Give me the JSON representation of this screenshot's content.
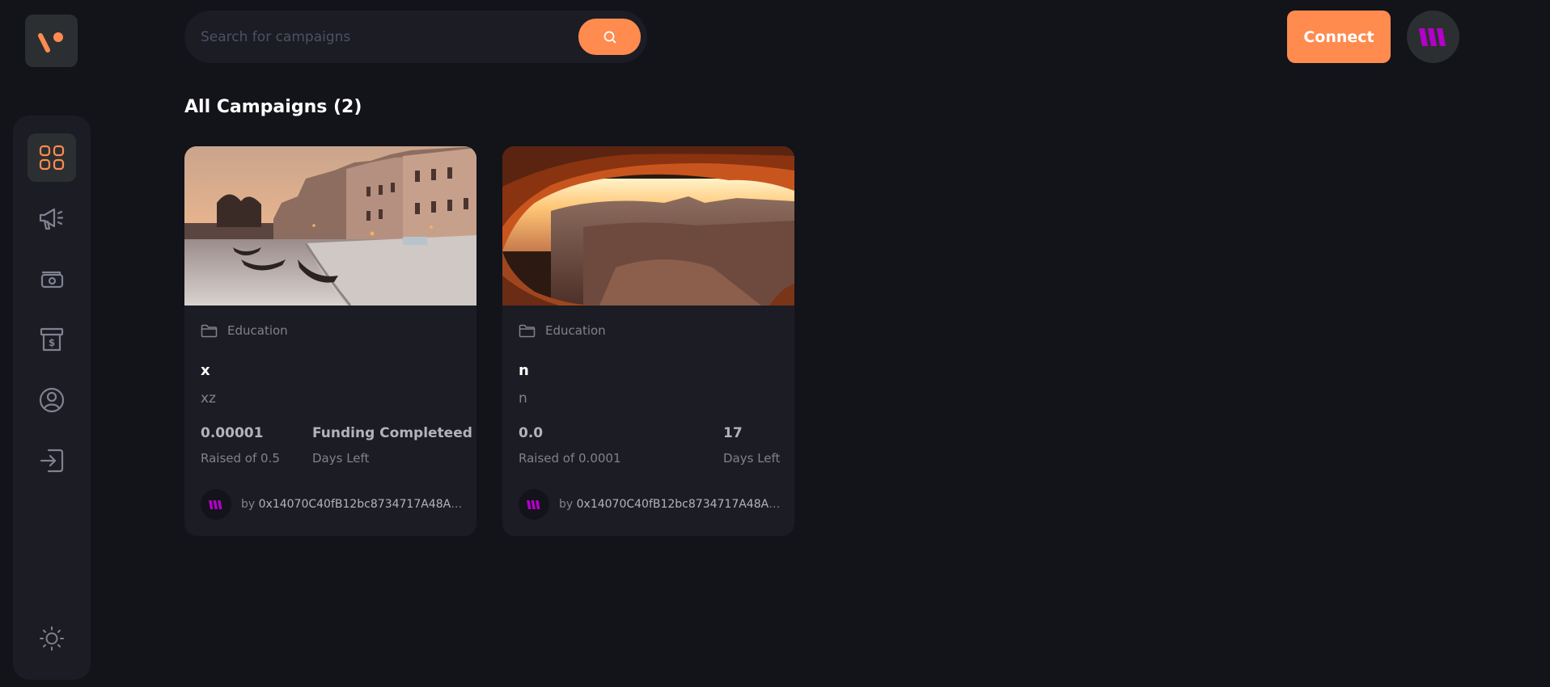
{
  "header": {
    "search": {
      "placeholder": "Search for campaigns"
    },
    "connect_label": "Connect"
  },
  "main": {
    "heading": "All Campaigns (2)",
    "campaigns": [
      {
        "category": "Education",
        "title": "x",
        "description": "xz",
        "raised_value": "0.00001",
        "raised_label": "Raised of 0.5",
        "days_value": "Funding Completeed",
        "days_label": "Days Left",
        "owner_prefix": "by",
        "owner": "0x14070C40fB12bc8734717A48A4..."
      },
      {
        "category": "Education",
        "title": "n",
        "description": "n",
        "raised_value": "0.0",
        "raised_label": "Raised of 0.0001",
        "days_value": "17",
        "days_label": "Days Left",
        "owner_prefix": "by",
        "owner": "0x14070C40fB12bc8734717A48A4..."
      }
    ]
  },
  "sidebar": {
    "items": [
      {
        "icon": "dashboard-icon",
        "active": true
      },
      {
        "icon": "megaphone-icon",
        "active": false
      },
      {
        "icon": "payment-icon",
        "active": false
      },
      {
        "icon": "withdraw-icon",
        "active": false
      },
      {
        "icon": "profile-icon",
        "active": false
      },
      {
        "icon": "logout-icon",
        "active": false
      },
      {
        "icon": "sun-icon",
        "active": false
      }
    ]
  },
  "colors": {
    "background": "#13131a",
    "panel": "#1c1c24",
    "accent": "#ff8b4f",
    "muted_text": "#808191",
    "stat_text": "#b2b3bd",
    "brand_purple": "#b400c8"
  }
}
